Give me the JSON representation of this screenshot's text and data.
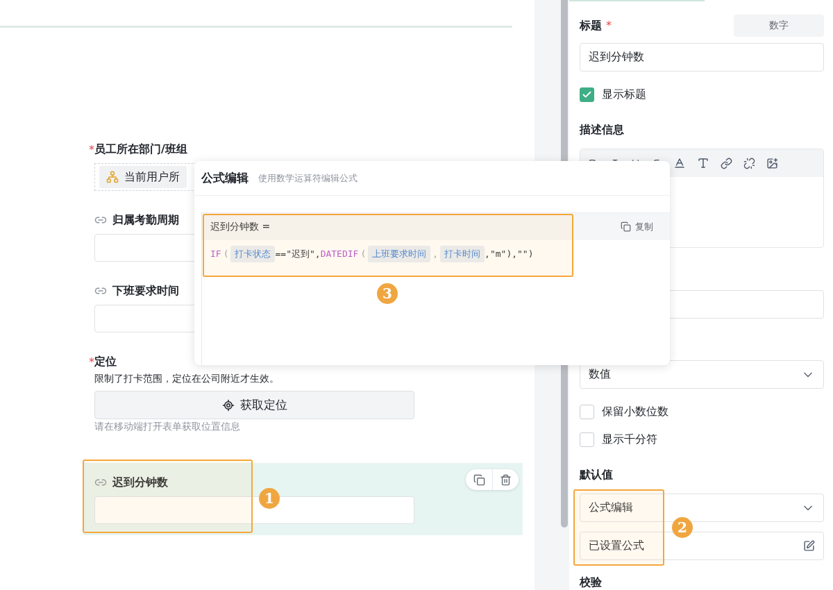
{
  "form": {
    "fields": [
      {
        "kind": "department",
        "label": "员工所在部门/班组",
        "required_mark": "*",
        "chip": "当前用户所",
        "selected": false
      },
      {
        "kind": "linked",
        "label": "归属考勤周期",
        "selected": false
      },
      {
        "kind": "linked",
        "label": "下班要求时间",
        "selected": false
      },
      {
        "kind": "location",
        "label": "定位",
        "required_mark": "*",
        "description": "限制了打卡范围，定位在公司附近才生效。",
        "button": "获取定位",
        "hint": "请在移动端打开表单获取位置信息",
        "selected": false
      },
      {
        "kind": "linked",
        "label": "迟到分钟数",
        "selected": true
      }
    ]
  },
  "properties": {
    "title_label": "标题",
    "title_mark": "*",
    "type_tag": "数字",
    "title_value": "迟到分钟数",
    "show_title": {
      "label": "显示标题",
      "checked": true
    },
    "description_label": "描述信息",
    "number_format": "数值",
    "options": [
      {
        "label": "保留小数位数",
        "checked": false
      },
      {
        "label": "显示千分符",
        "checked": false
      }
    ],
    "default_label": "默认值",
    "default_mode": "公式编辑",
    "default_value": "已设置公式",
    "validation_label": "校验"
  },
  "dialog": {
    "title": "公式编辑",
    "subtitle": "使用数学运算符编辑公式",
    "formula_name": "迟到分钟数 =",
    "copy_label": "复制",
    "tokens": [
      {
        "kind": "func",
        "text": "IF"
      },
      {
        "kind": "punct",
        "text": "("
      },
      {
        "kind": "field",
        "text": "打卡状态"
      },
      {
        "kind": "text",
        "text": "==\"迟到\","
      },
      {
        "kind": "func",
        "text": "DATEDIF"
      },
      {
        "kind": "punct",
        "text": "("
      },
      {
        "kind": "field",
        "text": "上班要求时间"
      },
      {
        "kind": "punct",
        "text": ","
      },
      {
        "kind": "field",
        "text": "打卡时间"
      },
      {
        "kind": "text",
        "text": ",\"m\"),\"\")"
      }
    ]
  },
  "annotations": [
    {
      "number": "1"
    },
    {
      "number": "2"
    },
    {
      "number": "3"
    }
  ]
}
